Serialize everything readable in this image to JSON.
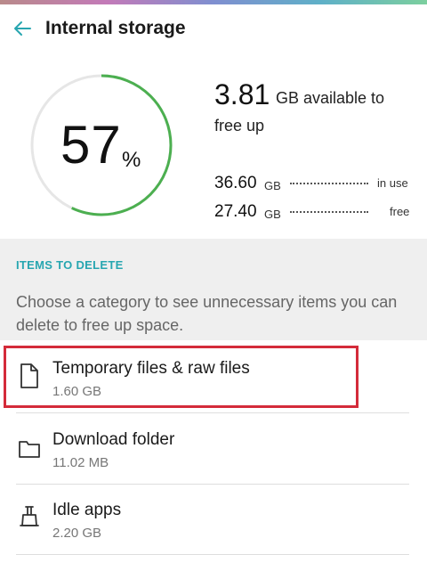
{
  "appbar": {
    "title": "Internal storage",
    "back_icon": "arrow-left-icon",
    "accent": "#27a6b0"
  },
  "usage": {
    "percent": 57,
    "percent_label": "57",
    "percent_sign": "%",
    "ring_color": "#4caf50",
    "available_value": "3.81",
    "available_unit": "GB available to",
    "available_line2": "free up",
    "in_use_value": "36.60",
    "in_use_unit": "GB",
    "in_use_label": "in use",
    "free_value": "27.40",
    "free_unit": "GB",
    "free_label": "free"
  },
  "section": {
    "title": "ITEMS TO DELETE",
    "description": "Choose a category to see unnecessary items you can delete to free up space."
  },
  "items": [
    {
      "title": "Temporary files & raw files",
      "size": "1.60 GB",
      "icon": "file-icon"
    },
    {
      "title": "Download folder",
      "size": "11.02 MB",
      "icon": "folder-icon"
    },
    {
      "title": "Idle apps",
      "size": "2.20 GB",
      "icon": "broom-icon"
    }
  ],
  "highlight_color": "#d42b3a"
}
